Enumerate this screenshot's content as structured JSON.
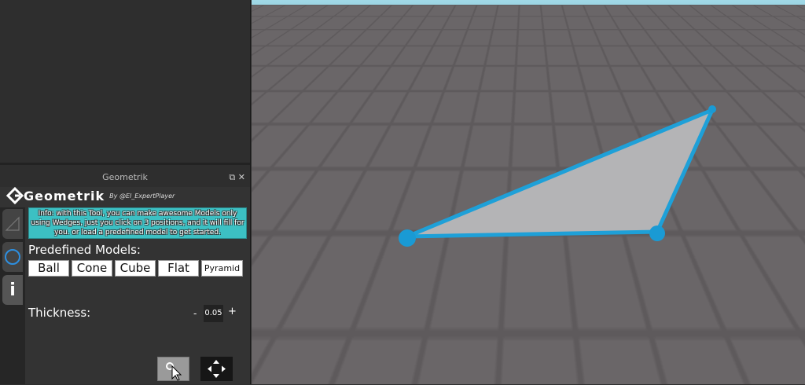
{
  "panel": {
    "title": "Geometrik",
    "restore_icon": "restore-icon",
    "close_icon": "close-icon"
  },
  "logo": {
    "name": "Geometrik",
    "byline": "By @El_ExpertPlayer"
  },
  "tabs": [
    {
      "icon": "wedge-triangle-icon"
    },
    {
      "icon": "circle-icon"
    },
    {
      "icon": "info-icon",
      "label": "i"
    }
  ],
  "info": "Info: with this Tool, you can make awesome Models only using Wedges, just you click on 3 positions, and it will fill for you. or load a predefined model to get started.",
  "predefined_label": "Predefined Models:",
  "models": [
    "Ball",
    "Cone",
    "Cube",
    "Flat",
    "Pyramid"
  ],
  "thickness": {
    "label": "Thickness:",
    "minus": "-",
    "value": "0.05",
    "plus": "+"
  },
  "tools": [
    {
      "icon": "select-cursor-icon"
    },
    {
      "icon": "move-arrows-icon"
    }
  ],
  "colors": {
    "accent": "#3cc0c3",
    "wedge_edge": "#1ea0d8",
    "wedge_fill": "#b4b4b6"
  }
}
